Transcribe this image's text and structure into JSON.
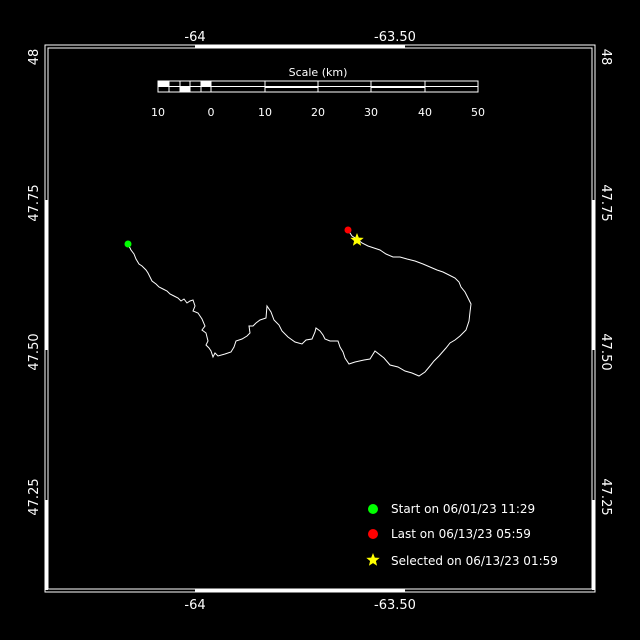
{
  "map": {
    "lon_ticks": [
      "-64",
      "-63.50"
    ],
    "lat_ticks": [
      "48",
      "47.75",
      "47.50",
      "47.25"
    ],
    "scale_bar": {
      "title": "Scale (km)",
      "labels": [
        "10",
        "0",
        "10",
        "20",
        "30",
        "40",
        "50"
      ]
    },
    "legend": {
      "start_label": "Start on 06/01/23 11:29",
      "last_label": "Last on 06/13/23 05:59",
      "selected_label": "Selected on 06/13/23 01:59"
    },
    "colors": {
      "background": "#000000",
      "frame": "#ffffff",
      "track": "#ffffff",
      "start_marker": "#00ff00",
      "last_marker": "#ff0000",
      "selected_marker": "#ffff00"
    }
  }
}
